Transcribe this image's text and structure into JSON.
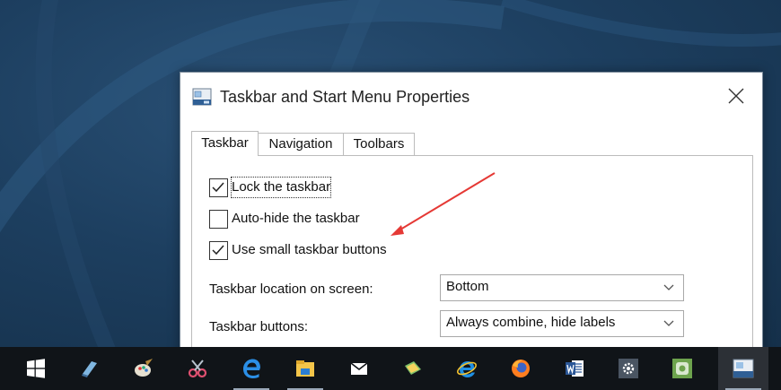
{
  "dialog": {
    "title": "Taskbar and Start Menu Properties",
    "tabs": [
      {
        "label": "Taskbar",
        "active": true
      },
      {
        "label": "Navigation",
        "active": false
      },
      {
        "label": "Toolbars",
        "active": false
      }
    ],
    "checkboxes": [
      {
        "label": "Lock the taskbar",
        "checked": true
      },
      {
        "label": "Auto-hide the taskbar",
        "checked": false
      },
      {
        "label": "Use small taskbar buttons",
        "checked": true
      }
    ],
    "location_label": "Taskbar location on screen:",
    "location_value": "Bottom",
    "buttons_label": "Taskbar buttons:",
    "buttons_value": "Always combine, hide labels"
  },
  "taskbar": {
    "items": [
      {
        "icon": "windows-start-icon"
      },
      {
        "icon": "notepad-icon"
      },
      {
        "icon": "paint-icon"
      },
      {
        "icon": "snipping-tool-icon"
      },
      {
        "icon": "edge-icon"
      },
      {
        "icon": "file-explorer-icon"
      },
      {
        "icon": "mail-icon"
      },
      {
        "icon": "photos-icon"
      },
      {
        "icon": "internet-explorer-icon"
      },
      {
        "icon": "firefox-icon"
      },
      {
        "icon": "word-icon"
      },
      {
        "icon": "settings-icon"
      },
      {
        "icon": "app-icon"
      },
      {
        "icon": "taskbar-properties-icon"
      }
    ]
  },
  "colors": {
    "accent": "#0078d7",
    "annotation_arrow": "#e53935",
    "desktop": "#1d3f60",
    "taskbar": "#101418"
  }
}
